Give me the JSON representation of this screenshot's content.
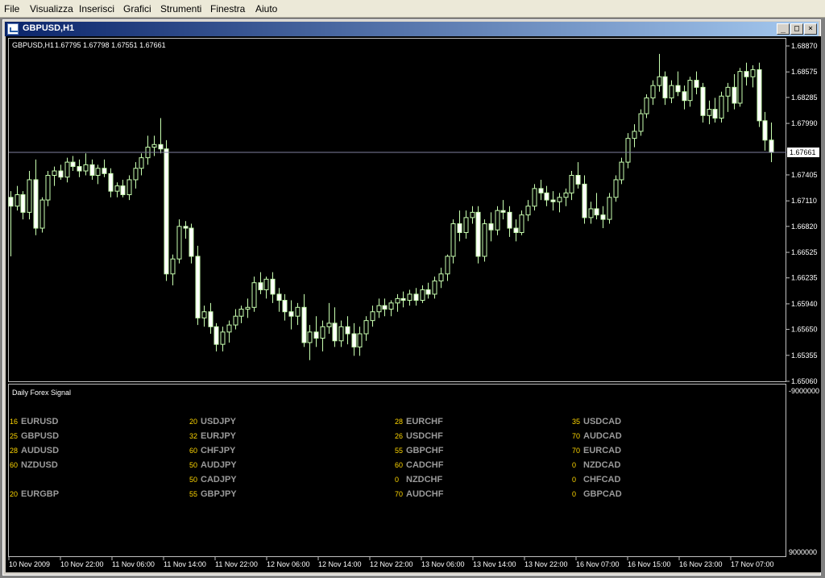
{
  "menu": [
    "File",
    "Visualizza",
    "Inserisci",
    "Grafici",
    "Strumenti",
    "Finestra",
    "Aiuto"
  ],
  "window": {
    "title": "GBPUSD,H1",
    "min_label": "_",
    "max_label": "□",
    "close_label": "×"
  },
  "chart_header": {
    "symbol_tf": "GBPUSD,H1",
    "ohlc": "1.67795 1.67798 1.67551 1.67661"
  },
  "price_axis": [
    "1.68870",
    "1.68575",
    "1.68285",
    "1.67990",
    "1.67405",
    "1.67110",
    "1.66820",
    "1.66525",
    "1.66235",
    "1.65940",
    "1.65650",
    "1.65355",
    "1.65060"
  ],
  "current_price_label": "1.67661",
  "time_axis": [
    "10 Nov 2009",
    "10 Nov 22:00",
    "11 Nov 06:00",
    "11 Nov 14:00",
    "11 Nov 22:00",
    "12 Nov 06:00",
    "12 Nov 14:00",
    "12 Nov 22:00",
    "13 Nov 06:00",
    "13 Nov 14:00",
    "13 Nov 22:00",
    "16 Nov 07:00",
    "16 Nov 15:00",
    "16 Nov 23:00",
    "17 Nov 07:00"
  ],
  "indicator": {
    "title": "Daily Forex Signal",
    "axis_top": "-9000000",
    "axis_bottom": "9000000",
    "columns": [
      [
        {
          "v": "16",
          "p": "EURUSD"
        },
        {
          "v": "25",
          "p": "GBPUSD"
        },
        {
          "v": "28",
          "p": "AUDUSD"
        },
        {
          "v": "60",
          "p": "NZDUSD"
        },
        {
          "v": "",
          "p": ""
        },
        {
          "v": "20",
          "p": "EURGBP"
        }
      ],
      [
        {
          "v": "20",
          "p": "USDJPY"
        },
        {
          "v": "32",
          "p": "EURJPY"
        },
        {
          "v": "60",
          "p": "CHFJPY"
        },
        {
          "v": "50",
          "p": "AUDJPY"
        },
        {
          "v": "50",
          "p": "CADJPY"
        },
        {
          "v": "55",
          "p": "GBPJPY"
        }
      ],
      [
        {
          "v": "28",
          "p": "EURCHF"
        },
        {
          "v": "26",
          "p": "USDCHF"
        },
        {
          "v": "55",
          "p": "GBPCHF"
        },
        {
          "v": "60",
          "p": "CADCHF"
        },
        {
          "v": "0",
          "p": "NZDCHF"
        },
        {
          "v": "70",
          "p": "AUDCHF"
        }
      ],
      [
        {
          "v": "35",
          "p": "USDCAD"
        },
        {
          "v": "70",
          "p": "AUDCAD"
        },
        {
          "v": "70",
          "p": "EURCAD"
        },
        {
          "v": "0",
          "p": "NZDCAD"
        },
        {
          "v": "0",
          "p": "CHFCAD"
        },
        {
          "v": "0",
          "p": "GBPCAD"
        }
      ]
    ]
  },
  "colors": {
    "background": "#000000",
    "candle": "#c8ffb0",
    "bull_body": "#000000",
    "bear_body": "#ffffff",
    "grid_line": "#8080a0",
    "value_text": "#ffd700",
    "pair_text": "#9a9a9a"
  },
  "chart_data": {
    "type": "candlestick",
    "symbol": "GBPUSD",
    "timeframe": "H1",
    "ylim": [
      1.6506,
      1.6887
    ],
    "current_price": 1.67661,
    "candles": [
      [
        1.6715,
        1.6722,
        1.6648,
        1.6705
      ],
      [
        1.6705,
        1.6728,
        1.67,
        1.6718
      ],
      [
        1.6718,
        1.6722,
        1.669,
        1.6698
      ],
      [
        1.6698,
        1.6745,
        1.669,
        1.6735
      ],
      [
        1.6735,
        1.6758,
        1.6672,
        1.668
      ],
      [
        1.668,
        1.6715,
        1.6675,
        1.6712
      ],
      [
        1.6712,
        1.6745,
        1.6705,
        1.674
      ],
      [
        1.674,
        1.675,
        1.6728,
        1.6745
      ],
      [
        1.6745,
        1.6752,
        1.6735,
        1.6738
      ],
      [
        1.6738,
        1.676,
        1.6732,
        1.6755
      ],
      [
        1.6755,
        1.6762,
        1.6745,
        1.675
      ],
      [
        1.675,
        1.6758,
        1.6738,
        1.6745
      ],
      [
        1.6745,
        1.6765,
        1.674,
        1.6752
      ],
      [
        1.6752,
        1.6758,
        1.6735,
        1.674
      ],
      [
        1.674,
        1.6752,
        1.673,
        1.6748
      ],
      [
        1.6748,
        1.6758,
        1.6738,
        1.6742
      ],
      [
        1.6742,
        1.6748,
        1.6715,
        1.6722
      ],
      [
        1.6722,
        1.6732,
        1.6715,
        1.6728
      ],
      [
        1.6728,
        1.6735,
        1.6715,
        1.6718
      ],
      [
        1.6718,
        1.674,
        1.6712,
        1.6735
      ],
      [
        1.6735,
        1.6755,
        1.6725,
        1.6748
      ],
      [
        1.6748,
        1.6765,
        1.674,
        1.676
      ],
      [
        1.676,
        1.6785,
        1.6752,
        1.6772
      ],
      [
        1.6772,
        1.6785,
        1.6762,
        1.6775
      ],
      [
        1.6775,
        1.6805,
        1.6765,
        1.677
      ],
      [
        1.677,
        1.678,
        1.662,
        1.6628
      ],
      [
        1.6628,
        1.665,
        1.6615,
        1.6645
      ],
      [
        1.6645,
        1.669,
        1.664,
        1.6682
      ],
      [
        1.6682,
        1.6688,
        1.6668,
        1.668
      ],
      [
        1.668,
        1.6685,
        1.664,
        1.6648
      ],
      [
        1.6648,
        1.666,
        1.657,
        1.6578
      ],
      [
        1.6578,
        1.6592,
        1.6568,
        1.6585
      ],
      [
        1.6585,
        1.6595,
        1.656,
        1.6568
      ],
      [
        1.6568,
        1.6572,
        1.654,
        1.6548
      ],
      [
        1.6548,
        1.6568,
        1.654,
        1.6562
      ],
      [
        1.6562,
        1.6575,
        1.655,
        1.657
      ],
      [
        1.657,
        1.6588,
        1.6565,
        1.658
      ],
      [
        1.658,
        1.6592,
        1.6572,
        1.6588
      ],
      [
        1.6588,
        1.66,
        1.6578,
        1.659
      ],
      [
        1.659,
        1.6625,
        1.6585,
        1.6618
      ],
      [
        1.6618,
        1.663,
        1.6605,
        1.661
      ],
      [
        1.661,
        1.6625,
        1.66,
        1.6622
      ],
      [
        1.6622,
        1.663,
        1.6595,
        1.6605
      ],
      [
        1.6605,
        1.6612,
        1.6585,
        1.6598
      ],
      [
        1.6598,
        1.6605,
        1.6575,
        1.6585
      ],
      [
        1.6585,
        1.6598,
        1.6565,
        1.658
      ],
      [
        1.658,
        1.6595,
        1.657,
        1.659
      ],
      [
        1.659,
        1.6605,
        1.6545,
        1.655
      ],
      [
        1.655,
        1.657,
        1.653,
        1.6562
      ],
      [
        1.6562,
        1.658,
        1.6545,
        1.6555
      ],
      [
        1.6555,
        1.6575,
        1.654,
        1.6568
      ],
      [
        1.6568,
        1.6595,
        1.656,
        1.6572
      ],
      [
        1.6572,
        1.659,
        1.6545,
        1.6552
      ],
      [
        1.6552,
        1.6575,
        1.6545,
        1.6568
      ],
      [
        1.6568,
        1.658,
        1.6548,
        1.656
      ],
      [
        1.656,
        1.6572,
        1.6535,
        1.6545
      ],
      [
        1.6545,
        1.6568,
        1.6535,
        1.656
      ],
      [
        1.656,
        1.658,
        1.6552,
        1.6575
      ],
      [
        1.6575,
        1.6592,
        1.6568,
        1.6585
      ],
      [
        1.6585,
        1.66,
        1.6578,
        1.6592
      ],
      [
        1.6592,
        1.66,
        1.658,
        1.6588
      ],
      [
        1.6588,
        1.6598,
        1.658,
        1.6595
      ],
      [
        1.6595,
        1.6605,
        1.6585,
        1.66
      ],
      [
        1.66,
        1.6608,
        1.659,
        1.6598
      ],
      [
        1.6598,
        1.661,
        1.6592,
        1.6605
      ],
      [
        1.6605,
        1.6612,
        1.6592,
        1.6598
      ],
      [
        1.6598,
        1.6615,
        1.6595,
        1.661
      ],
      [
        1.661,
        1.6618,
        1.66,
        1.6605
      ],
      [
        1.6605,
        1.6625,
        1.66,
        1.662
      ],
      [
        1.662,
        1.6635,
        1.6612,
        1.6628
      ],
      [
        1.6628,
        1.665,
        1.662,
        1.6648
      ],
      [
        1.6648,
        1.669,
        1.664,
        1.6685
      ],
      [
        1.6685,
        1.67,
        1.6665,
        1.6675
      ],
      [
        1.6675,
        1.67,
        1.6668,
        1.6692
      ],
      [
        1.6692,
        1.6705,
        1.6685,
        1.6698
      ],
      [
        1.6698,
        1.6705,
        1.664,
        1.6648
      ],
      [
        1.6648,
        1.669,
        1.6642,
        1.6685
      ],
      [
        1.6685,
        1.6698,
        1.6665,
        1.6678
      ],
      [
        1.6678,
        1.6705,
        1.6672,
        1.67
      ],
      [
        1.67,
        1.6712,
        1.669,
        1.6698
      ],
      [
        1.6698,
        1.6705,
        1.667,
        1.668
      ],
      [
        1.668,
        1.669,
        1.6665,
        1.6675
      ],
      [
        1.6675,
        1.67,
        1.6672,
        1.6695
      ],
      [
        1.6695,
        1.6712,
        1.6688,
        1.6705
      ],
      [
        1.6705,
        1.673,
        1.67,
        1.6725
      ],
      [
        1.6725,
        1.6735,
        1.6712,
        1.672
      ],
      [
        1.672,
        1.6728,
        1.6705,
        1.6712
      ],
      [
        1.6712,
        1.6722,
        1.67,
        1.671
      ],
      [
        1.671,
        1.672,
        1.6698,
        1.6715
      ],
      [
        1.6715,
        1.6725,
        1.6705,
        1.672
      ],
      [
        1.672,
        1.6745,
        1.6712,
        1.674
      ],
      [
        1.674,
        1.6755,
        1.6725,
        1.673
      ],
      [
        1.673,
        1.674,
        1.6685,
        1.6692
      ],
      [
        1.6692,
        1.671,
        1.6685,
        1.6702
      ],
      [
        1.6702,
        1.672,
        1.669,
        1.6695
      ],
      [
        1.6695,
        1.6705,
        1.668,
        1.669
      ],
      [
        1.669,
        1.672,
        1.6685,
        1.6715
      ],
      [
        1.6715,
        1.674,
        1.671,
        1.6735
      ],
      [
        1.6735,
        1.676,
        1.673,
        1.6755
      ],
      [
        1.6755,
        1.6788,
        1.6748,
        1.6782
      ],
      [
        1.6782,
        1.6798,
        1.6772,
        1.679
      ],
      [
        1.679,
        1.6815,
        1.6785,
        1.681
      ],
      [
        1.681,
        1.6832,
        1.6805,
        1.6828
      ],
      [
        1.6828,
        1.6848,
        1.682,
        1.6842
      ],
      [
        1.6842,
        1.6878,
        1.6835,
        1.6852
      ],
      [
        1.6852,
        1.6858,
        1.682,
        1.6828
      ],
      [
        1.6828,
        1.6848,
        1.6822,
        1.6842
      ],
      [
        1.6842,
        1.6858,
        1.683,
        1.6835
      ],
      [
        1.6835,
        1.6842,
        1.6815,
        1.6825
      ],
      [
        1.6825,
        1.6852,
        1.6818,
        1.6848
      ],
      [
        1.6848,
        1.6858,
        1.6832,
        1.684
      ],
      [
        1.684,
        1.6845,
        1.68,
        1.6808
      ],
      [
        1.6808,
        1.6825,
        1.6798,
        1.6815
      ],
      [
        1.6815,
        1.6828,
        1.68,
        1.6805
      ],
      [
        1.6805,
        1.6835,
        1.68,
        1.683
      ],
      [
        1.683,
        1.6845,
        1.6812,
        1.684
      ],
      [
        1.684,
        1.6855,
        1.6815,
        1.6822
      ],
      [
        1.6822,
        1.6862,
        1.6818,
        1.6858
      ],
      [
        1.6858,
        1.6868,
        1.6842,
        1.6852
      ],
      [
        1.6852,
        1.6865,
        1.684,
        1.686
      ],
      [
        1.686,
        1.6868,
        1.6795,
        1.6802
      ],
      [
        1.6802,
        1.6812,
        1.6768,
        1.678
      ],
      [
        1.678,
        1.68,
        1.6755,
        1.6766
      ]
    ]
  }
}
